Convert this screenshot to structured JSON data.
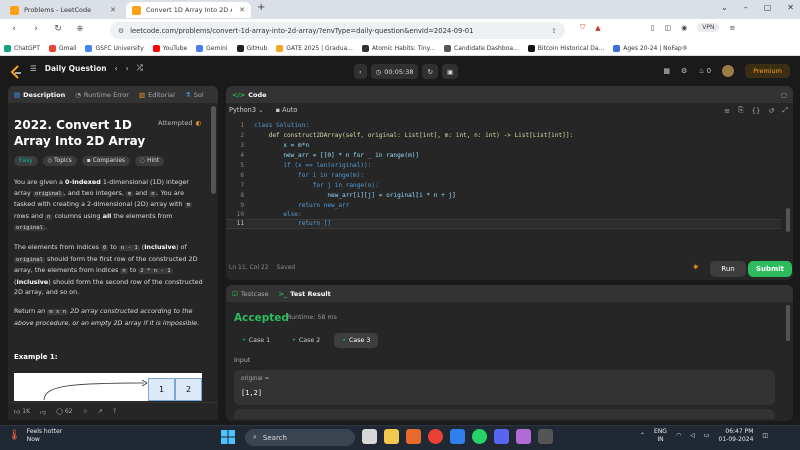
{
  "browser": {
    "tabs": [
      {
        "title": "Problems - LeetCode"
      },
      {
        "title": "Convert 1D Array Into 2D Array"
      }
    ],
    "new_tab": "+",
    "url": "leetcode.com/problems/convert-1d-array-into-2d-array/?envType=daily-question&envId=2024-09-01",
    "vpn": "VPN",
    "bookmarks": [
      "ChatGPT",
      "Gmail",
      "GSFC University",
      "YouTube",
      "Gemini",
      "GitHub",
      "GATE 2025 | Gradua...",
      "Atomic Habits: Tiny...",
      "Candidate Dashboa...",
      "Bitcoin Historical Da...",
      "Ages 20-24 | NoFap®"
    ]
  },
  "lc_nav": {
    "daily": "Daily Question",
    "timer": "00:05:38",
    "fire_count": "0",
    "premium": "Premium"
  },
  "description": {
    "tabs": [
      "Description",
      "Runtime Error",
      "Editorial",
      "Sol"
    ],
    "title": "2022. Convert 1D Array Into 2D Array",
    "status": "Attempted",
    "tags": [
      "Easy",
      "Topics",
      "Companies",
      "Hint"
    ],
    "p1": {
      "a": "You are given a ",
      "b": "0-indexed",
      "c": " 1-dimensional (1D) integer array ",
      "d": "original",
      "e": ", and two integers, ",
      "f": "m",
      "g": " and ",
      "h": "n",
      "i": ". You are tasked with creating a 2-dimensional (2D) array with ",
      "j": "m",
      "k": " rows and ",
      "l": "n",
      "m": " columns using ",
      "n": "all",
      "o": " the elements from ",
      "p": "original",
      "q": "."
    },
    "p2": {
      "a": "The elements from indices ",
      "b": "0",
      "c": " to ",
      "d": "n - 1",
      "e": " (",
      "f": "inclusive",
      "g": ") of ",
      "h": "original",
      "i": " should form the first row of the constructed 2D array, the elements from indices ",
      "j": "n",
      "k": " to ",
      "l": "2 * n - 1",
      "m": " (",
      "n": "inclusive",
      "o": ") should form the second row of the constructed 2D array, and so on."
    },
    "p3": {
      "a": "Return ",
      "b": "an ",
      "c": "m x n",
      "d": " 2D array constructed according to the above procedure, or an empty 2D array if it is impossible."
    },
    "example_title": "Example 1:",
    "example_cells": [
      "1",
      "2"
    ],
    "likes": "1K",
    "comments": "62"
  },
  "code": {
    "header": "Code",
    "language": "Python3",
    "auto": "Auto",
    "lines": [
      "class Solution:",
      "    def construct2DArray(self, original: List[int], m: int, n: int) -> List[List[int]]:",
      "        x = m*n",
      "        new_arr = [[0] * n for _ in range(m)]",
      "        if (x == len(original)):",
      "            for i in range(m):",
      "                for j in range(n):",
      "                    new_arr[i][j] = original[i * n + j]",
      "            return new_arr",
      "        else:",
      "            return []"
    ],
    "line_numbers": [
      "1",
      "2",
      "3",
      "4",
      "5",
      "6",
      "7",
      "8",
      "9",
      "10",
      "11"
    ],
    "status_pos": "Ln 11, Col 22",
    "status_saved": "Saved",
    "run": "Run",
    "submit": "Submit"
  },
  "result": {
    "tab_testcase": "Testcase",
    "tab_result": "Test Result",
    "verdict": "Accepted",
    "runtime": "Runtime: 58 ms",
    "cases": [
      "Case 1",
      "Case 2",
      "Case 3"
    ],
    "selected_case": 2,
    "input_label": "Input",
    "var_name": "original =",
    "var_value": "[1,2]"
  },
  "taskbar": {
    "weather_title": "Feels hotter",
    "weather_sub": "Now",
    "search": "Search",
    "lang": "ENG",
    "region": "IN",
    "time": "06:47 PM",
    "date": "01-09-2024"
  },
  "colors": {
    "accent_orange": "#ffa116",
    "accepted_green": "#2cbb5d",
    "easy_teal": "#00b8a3"
  }
}
